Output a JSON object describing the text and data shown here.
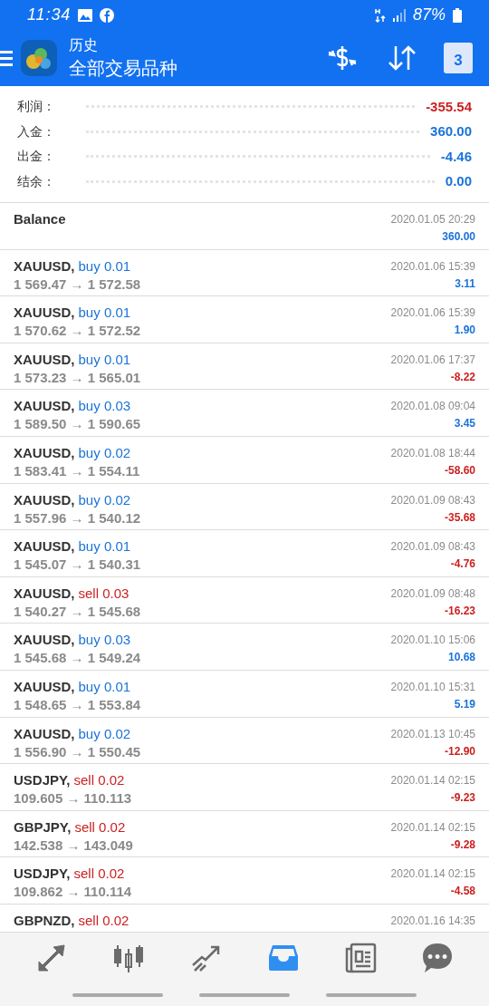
{
  "status_bar": {
    "time": "11:34",
    "battery": "87%"
  },
  "app_bar": {
    "title": "历史",
    "subtitle": "全部交易品种",
    "calendar_day": "3"
  },
  "summary": [
    {
      "label": "利润：",
      "value": "-355.54",
      "negative": true
    },
    {
      "label": "入金：",
      "value": "360.00",
      "negative": false
    },
    {
      "label": "出金：",
      "value": "-4.46",
      "negative": false
    },
    {
      "label": "结余：",
      "value": "0.00",
      "negative": false
    }
  ],
  "deals": [
    {
      "kind": "balance",
      "symbol": "Balance",
      "time": "2020.01.05 20:29",
      "profit": "360.00",
      "negative": false
    },
    {
      "kind": "trade",
      "symbol": "XAUUSD,",
      "side": "buy",
      "lots": "0.01",
      "prices": "1 569.47 → 1 572.58",
      "time": "2020.01.06 15:39",
      "profit": "3.11",
      "negative": false
    },
    {
      "kind": "trade",
      "symbol": "XAUUSD,",
      "side": "buy",
      "lots": "0.01",
      "prices": "1 570.62 → 1 572.52",
      "time": "2020.01.06 15:39",
      "profit": "1.90",
      "negative": false
    },
    {
      "kind": "trade",
      "symbol": "XAUUSD,",
      "side": "buy",
      "lots": "0.01",
      "prices": "1 573.23 → 1 565.01",
      "time": "2020.01.06 17:37",
      "profit": "-8.22",
      "negative": true
    },
    {
      "kind": "trade",
      "symbol": "XAUUSD,",
      "side": "buy",
      "lots": "0.03",
      "prices": "1 589.50 → 1 590.65",
      "time": "2020.01.08 09:04",
      "profit": "3.45",
      "negative": false
    },
    {
      "kind": "trade",
      "symbol": "XAUUSD,",
      "side": "buy",
      "lots": "0.02",
      "prices": "1 583.41 → 1 554.11",
      "time": "2020.01.08 18:44",
      "profit": "-58.60",
      "negative": true
    },
    {
      "kind": "trade",
      "symbol": "XAUUSD,",
      "side": "buy",
      "lots": "0.02",
      "prices": "1 557.96 → 1 540.12",
      "time": "2020.01.09 08:43",
      "profit": "-35.68",
      "negative": true
    },
    {
      "kind": "trade",
      "symbol": "XAUUSD,",
      "side": "buy",
      "lots": "0.01",
      "prices": "1 545.07 → 1 540.31",
      "time": "2020.01.09 08:43",
      "profit": "-4.76",
      "negative": true
    },
    {
      "kind": "trade",
      "symbol": "XAUUSD,",
      "side": "sell",
      "lots": "0.03",
      "prices": "1 540.27 → 1 545.68",
      "time": "2020.01.09 08:48",
      "profit": "-16.23",
      "negative": true
    },
    {
      "kind": "trade",
      "symbol": "XAUUSD,",
      "side": "buy",
      "lots": "0.03",
      "prices": "1 545.68 → 1 549.24",
      "time": "2020.01.10 15:06",
      "profit": "10.68",
      "negative": false
    },
    {
      "kind": "trade",
      "symbol": "XAUUSD,",
      "side": "buy",
      "lots": "0.01",
      "prices": "1 548.65 → 1 553.84",
      "time": "2020.01.10 15:31",
      "profit": "5.19",
      "negative": false
    },
    {
      "kind": "trade",
      "symbol": "XAUUSD,",
      "side": "buy",
      "lots": "0.02",
      "prices": "1 556.90 → 1 550.45",
      "time": "2020.01.13 10:45",
      "profit": "-12.90",
      "negative": true
    },
    {
      "kind": "trade",
      "symbol": "USDJPY,",
      "side": "sell",
      "lots": "0.02",
      "prices": "109.605 → 110.113",
      "time": "2020.01.14 02:15",
      "profit": "-9.23",
      "negative": true
    },
    {
      "kind": "trade",
      "symbol": "GBPJPY,",
      "side": "sell",
      "lots": "0.02",
      "prices": "142.538 → 143.049",
      "time": "2020.01.14 02:15",
      "profit": "-9.28",
      "negative": true
    },
    {
      "kind": "trade",
      "symbol": "USDJPY,",
      "side": "sell",
      "lots": "0.02",
      "prices": "109.862 → 110.114",
      "time": "2020.01.14 02:15",
      "profit": "-4.58",
      "negative": true
    },
    {
      "kind": "trade",
      "symbol": "GBPNZD,",
      "side": "sell",
      "lots": "0.02",
      "time": "2020.01.16 14:35"
    }
  ],
  "nav": [
    {
      "kind": "trade",
      "selected": false
    },
    {
      "kind": "candles",
      "selected": false
    },
    {
      "kind": "chart",
      "selected": false
    },
    {
      "kind": "inbox",
      "selected": true
    },
    {
      "kind": "news",
      "selected": false
    },
    {
      "kind": "chat",
      "selected": false
    }
  ]
}
